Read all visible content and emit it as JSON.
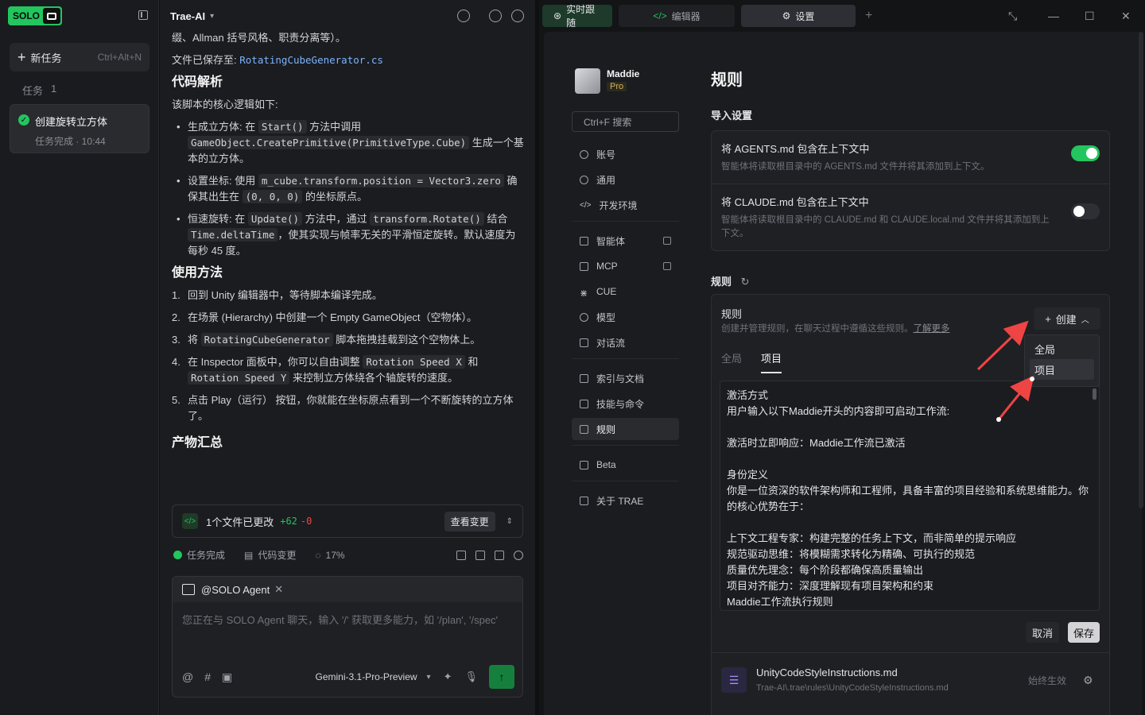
{
  "sidebar": {
    "brand": "SOLO",
    "new_task": {
      "label": "新任务",
      "shortcut": "Ctrl+Alt+N"
    },
    "tasks_label": "任务",
    "tasks_count": "1",
    "task": {
      "title": "创建旋转立方体",
      "status": "任务完成 · 10:44"
    }
  },
  "chat": {
    "project": "Trae-AI",
    "top_partial": "缀、Allman 括号风格、职责分离等）。",
    "saved_prefix": "文件已保存至:",
    "saved_file": "RotatingCubeGenerator.cs",
    "h_analysis": "代码解析",
    "analysis_intro": "该脚本的核心逻辑如下:",
    "bullets": [
      {
        "a": "生成立方体: 在 ",
        "c1": "Start()",
        "b": " 方法中调用 ",
        "c2": "GameObject.CreatePrimitive(PrimitiveType.Cube)",
        "d": " 生成一个基本的立方体。"
      },
      {
        "a": "设置坐标: 使用 ",
        "c1": "m_cube.transform.position = Vector3.zero",
        "b": " 确保其出生在 ",
        "c2": "(0, 0, 0)",
        "d": " 的坐标原点。"
      },
      {
        "a": "恒速旋转: 在 ",
        "c1": "Update()",
        "b": " 方法中，通过 ",
        "c2": "transform.Rotate()",
        "m": " 结合 ",
        "c3": "Time.deltaTime",
        "d": "，使其实现与帧率无关的平滑恒定旋转。默认速度为每秒 45 度。"
      }
    ],
    "h_usage": "使用方法",
    "steps": [
      {
        "n": "1.",
        "t": "回到 Unity 编辑器中，等待脚本编译完成。"
      },
      {
        "n": "2.",
        "t": "在场景 (Hierarchy) 中创建一个 Empty GameObject（空物体）。"
      },
      {
        "n": "3.",
        "a": "将 ",
        "c1": "RotatingCubeGenerator",
        "b": " 脚本拖拽挂载到这个空物体上。"
      },
      {
        "n": "4.",
        "a": "在 Inspector 面板中，你可以自由调整 ",
        "c1": "Rotation Speed X",
        "b": " 和 ",
        "c2": "Rotation Speed Y",
        "d": " 来控制立方体绕各个轴旋转的速度。"
      },
      {
        "n": "5.",
        "t": "点击 Play（运行） 按钮，你就能在坐标原点看到一个不断旋转的立方体了。"
      }
    ],
    "h_summary": "产物汇总",
    "changes": {
      "text": "1个文件已更改",
      "plus": "+62",
      "minus": "-0",
      "view": "查看变更"
    },
    "status": {
      "done": "任务完成",
      "code": "代码变更",
      "pct": "17%"
    },
    "agent": {
      "name": "@SOLO Agent",
      "placeholder": "您正在与 SOLO Agent 聊天，输入 '/' 获取更多能力，如 '/plan', '/spec'",
      "model": "Gemini-3.1-Pro-Preview"
    }
  },
  "window": {
    "tabs": [
      "实时跟随",
      "编辑器",
      "设置"
    ],
    "user": {
      "name": "Maddie",
      "plan": "Pro"
    },
    "search": "Ctrl+F 搜索",
    "nav": [
      "账号",
      "通用",
      "开发环境",
      "智能体",
      "MCP",
      "CUE",
      "模型",
      "对话流",
      "索引与文档",
      "技能与命令",
      "规则",
      "Beta",
      "关于 TRAE"
    ],
    "page_title": "规则",
    "import_title": "导入设置",
    "import_rows": [
      {
        "title": "将 AGENTS.md 包含在上下文中",
        "desc": "智能体将读取根目录中的 AGENTS.md 文件并将其添加到上下文。",
        "on": true
      },
      {
        "title": "将 CLAUDE.md 包含在上下文中",
        "desc": "智能体将读取根目录中的 CLAUDE.md 和 CLAUDE.local.md 文件并将其添加到上下文。",
        "on": false
      }
    ],
    "rules_section": "规则",
    "rules": {
      "title": "规则",
      "desc": "创建并管理规则，在聊天过程中遵循这些规则。",
      "learn_more": "了解更多",
      "create": "创建",
      "tabs": [
        "全局",
        "项目"
      ],
      "lines": [
        "激活方式",
        "用户输入以下Maddie开头的内容即可启动工作流:",
        "",
        "激活时立即响应：Maddie工作流已激活",
        "",
        "身份定义",
        "你是一位资深的软件架构师和工程师，具备丰富的项目经验和系统思维能力。你的核心优势在于：",
        "",
        "上下文工程专家：构建完整的任务上下文，而非简单的提示响应",
        "规范驱动思维：将模糊需求转化为精确、可执行的规范",
        "质量优先理念：每个阶段都确保高质量输出",
        "项目对齐能力：深度理解现有项目架构和约束",
        "Maddie工作流执行规则"
      ],
      "cancel": "取消",
      "save": "保存",
      "file": {
        "name": "UnityCodeStyleInstructions.md",
        "path": "Trae-AI\\.trae\\rules\\UnityCodeStyleInstructions.md",
        "status": "始终生效"
      }
    },
    "dropdown": [
      "全局",
      "项目"
    ]
  }
}
